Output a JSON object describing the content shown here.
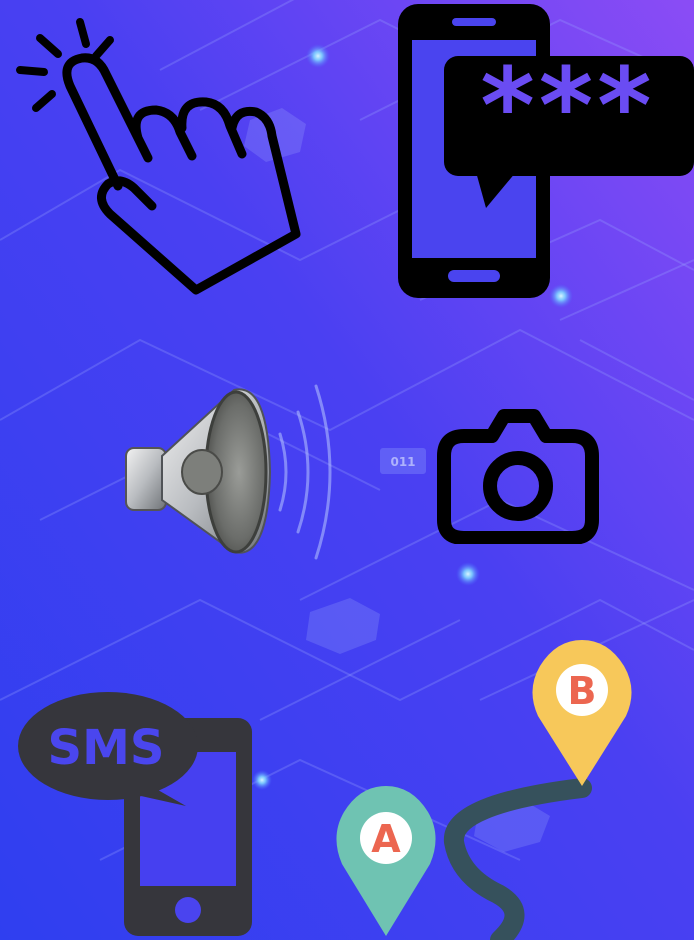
{
  "background": {
    "gradient_start": "#3142ee",
    "gradient_mid": "#4a40f2",
    "gradient_end": "#8b4cf5",
    "circuit_tag": "011"
  },
  "icons": {
    "tap": {
      "name": "tap-gesture-icon"
    },
    "password_sms": {
      "name": "phone-password-icon",
      "masked_text": "***"
    },
    "speaker": {
      "name": "speaker-sound-icon"
    },
    "camera": {
      "name": "camera-icon"
    },
    "sms_phone": {
      "name": "sms-phone-icon",
      "bubble_text": "SMS"
    },
    "route": {
      "name": "route-map-icon",
      "pin_a_label": "A",
      "pin_b_label": "B",
      "pin_a_color": "#6fc3b2",
      "pin_b_color": "#f7c85a",
      "letter_color": "#ec6650",
      "road_color": "#36515c"
    }
  }
}
